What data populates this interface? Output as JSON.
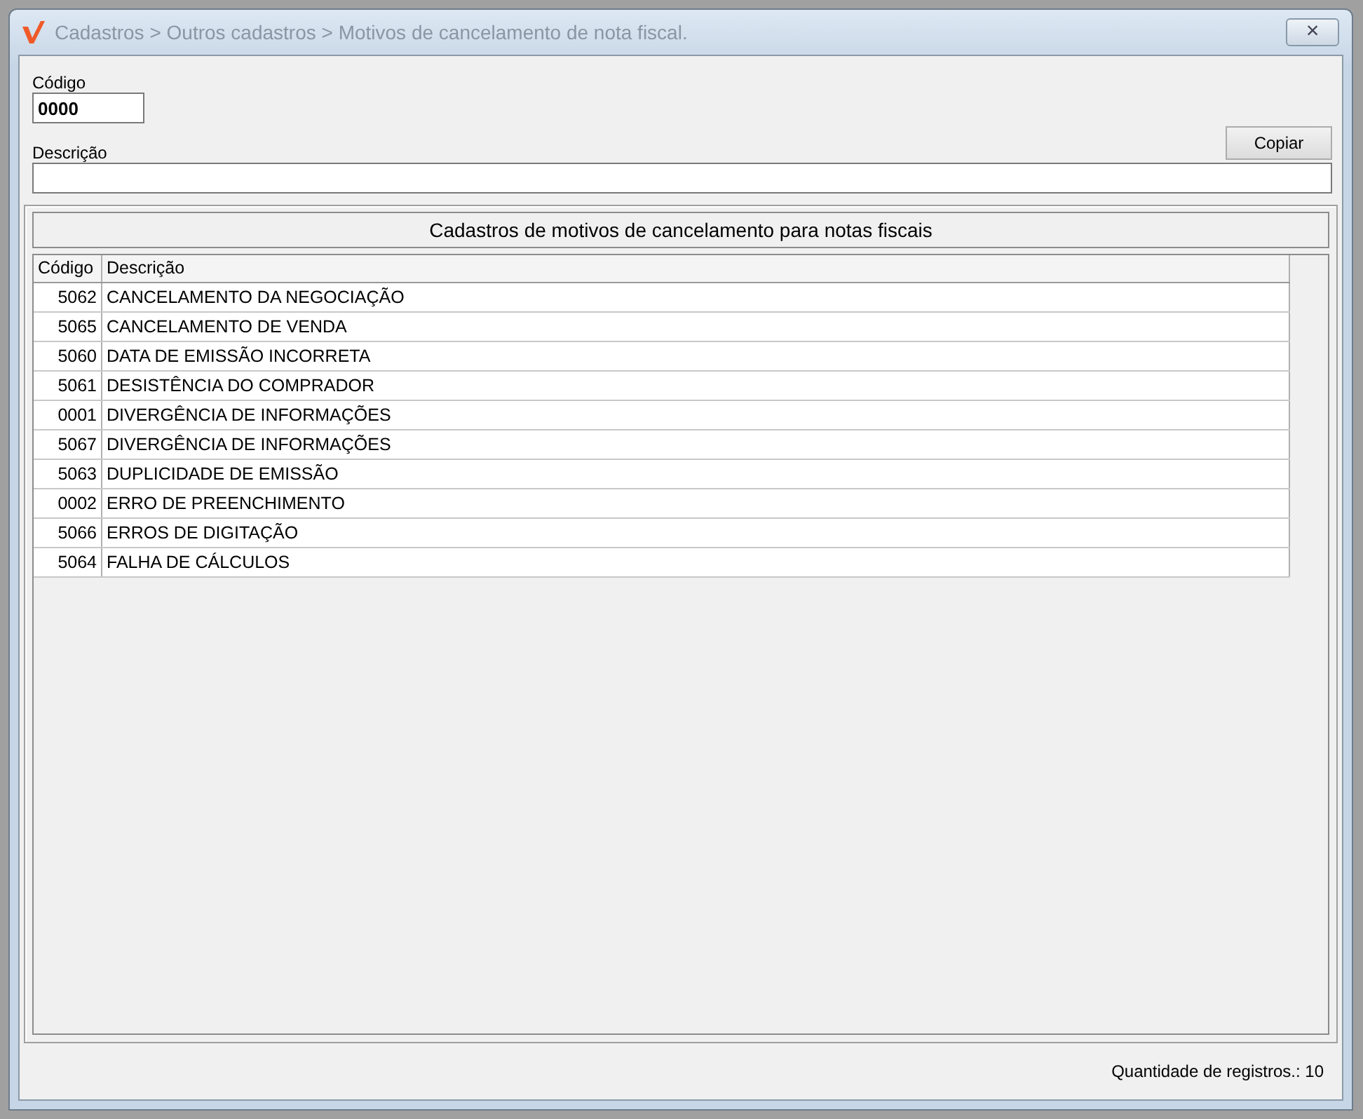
{
  "window": {
    "title": "Cadastros > Outros cadastros > Motivos de cancelamento de nota fiscal.",
    "close": "×"
  },
  "form": {
    "code_label": "Código",
    "code_value": "0000",
    "description_label": "Descrição",
    "copy_button": "Copiar"
  },
  "table": {
    "title": "Cadastros de motivos de cancelamento para notas fiscais",
    "columns": [
      "Código",
      "Descrição"
    ],
    "rows": [
      {
        "code": "5062",
        "description": "CANCELAMENTO DA NEGOCIAÇÃO"
      },
      {
        "code": "5065",
        "description": "CANCELAMENTO DE VENDA"
      },
      {
        "code": "5060",
        "description": "DATA DE EMISSÃO INCORRETA"
      },
      {
        "code": "5061",
        "description": "DESISTÊNCIA DO COMPRADOR"
      },
      {
        "code": "0001",
        "description": "DIVERGÊNCIA DE INFORMAÇÕES"
      },
      {
        "code": "5067",
        "description": "DIVERGÊNCIA DE INFORMAÇÕES"
      },
      {
        "code": "5063",
        "description": "DUPLICIDADE DE EMISSÃO"
      },
      {
        "code": "0002",
        "description": "ERRO DE PREENCHIMENTO"
      },
      {
        "code": "5066",
        "description": "ERROS DE DIGITAÇÃO"
      },
      {
        "code": "5064",
        "description": "FALHA DE CÁLCULOS"
      }
    ]
  },
  "status_bar": {
    "record_count": "Quantidade de registros.: 10"
  }
}
